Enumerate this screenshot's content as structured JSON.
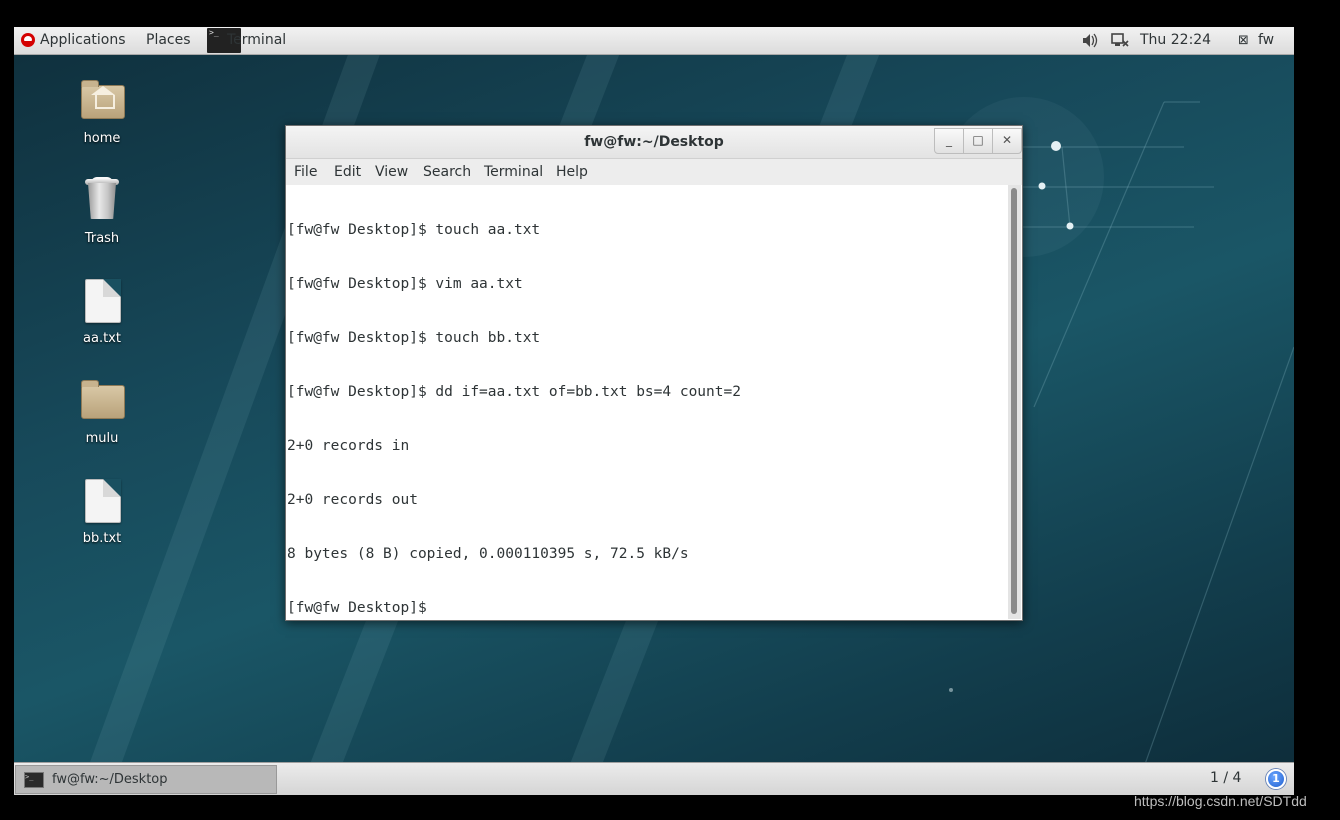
{
  "top_panel": {
    "applications_label": "Applications",
    "places_label": "Places",
    "active_app_label": "Terminal",
    "clock": "Thu 22:24",
    "user_label": "fw"
  },
  "desktop_icons": [
    {
      "label": "home",
      "icon": "home-folder-icon"
    },
    {
      "label": "Trash",
      "icon": "trash-icon"
    },
    {
      "label": "aa.txt",
      "icon": "text-file-icon"
    },
    {
      "label": "mulu",
      "icon": "folder-icon"
    },
    {
      "label": "bb.txt",
      "icon": "text-file-icon"
    }
  ],
  "window": {
    "title": "fw@fw:~/Desktop",
    "buttons": {
      "minimize": "_",
      "maximize": "□",
      "close": "✕"
    },
    "menu": [
      "File",
      "Edit",
      "View",
      "Search",
      "Terminal",
      "Help"
    ],
    "lines": [
      "[fw@fw Desktop]$ touch aa.txt",
      "[fw@fw Desktop]$ vim aa.txt",
      "[fw@fw Desktop]$ touch bb.txt",
      "[fw@fw Desktop]$ dd if=aa.txt of=bb.txt bs=4 count=2",
      "2+0 records in",
      "2+0 records out",
      "8 bytes (8 B) copied, 0.000110395 s, 72.5 kB/s",
      "[fw@fw Desktop]$ "
    ]
  },
  "bottom_panel": {
    "task_label": "fw@fw:~/Desktop",
    "workspace": "1 / 4",
    "notification_count": "1"
  },
  "watermark": "https://blog.csdn.net/SDTdd",
  "colors": {
    "accent": "#1f5fd0",
    "redhat": "#d40000",
    "desktop": "#17495a"
  }
}
